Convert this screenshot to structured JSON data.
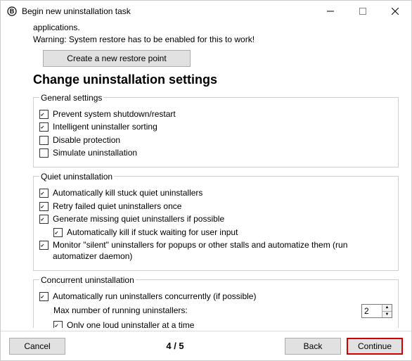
{
  "window": {
    "title": "Begin new uninstallation task"
  },
  "intro": {
    "line1": "applications.",
    "line2": "Warning: System restore has to be enabled for this to work!",
    "restore_button": "Create a new restore point"
  },
  "heading": "Change uninstallation settings",
  "groups": {
    "general": {
      "legend": "General settings",
      "items": [
        {
          "label": "Prevent system shutdown/restart",
          "checked": true
        },
        {
          "label": "Intelligent uninstaller sorting",
          "checked": true
        },
        {
          "label": "Disable protection",
          "checked": false
        },
        {
          "label": "Simulate uninstallation",
          "checked": false
        }
      ]
    },
    "quiet": {
      "legend": "Quiet uninstallation",
      "items": [
        {
          "label": "Automatically kill stuck quiet uninstallers",
          "checked": true
        },
        {
          "label": "Retry failed quiet uninstallers once",
          "checked": true
        },
        {
          "label": "Generate missing quiet uninstallers if possible",
          "checked": true
        },
        {
          "label": "Automatically kill if stuck waiting for user input",
          "checked": true,
          "indent": true
        },
        {
          "label": "Monitor \"silent\" uninstallers for popups or other stalls and automatize them (run automatizer daemon)",
          "checked": true
        }
      ]
    },
    "concurrent": {
      "legend": "Concurrent uninstallation",
      "auto": {
        "label": "Automatically run uninstallers concurrently (if possible)",
        "checked": true
      },
      "max_label": "Max number of running uninstallers:",
      "max_value": "2",
      "only_one": {
        "label": "Only one loud uninstaller at a time",
        "checked": true
      }
    }
  },
  "footer": {
    "cancel": "Cancel",
    "page": "4 / 5",
    "back": "Back",
    "continue": "Continue"
  }
}
